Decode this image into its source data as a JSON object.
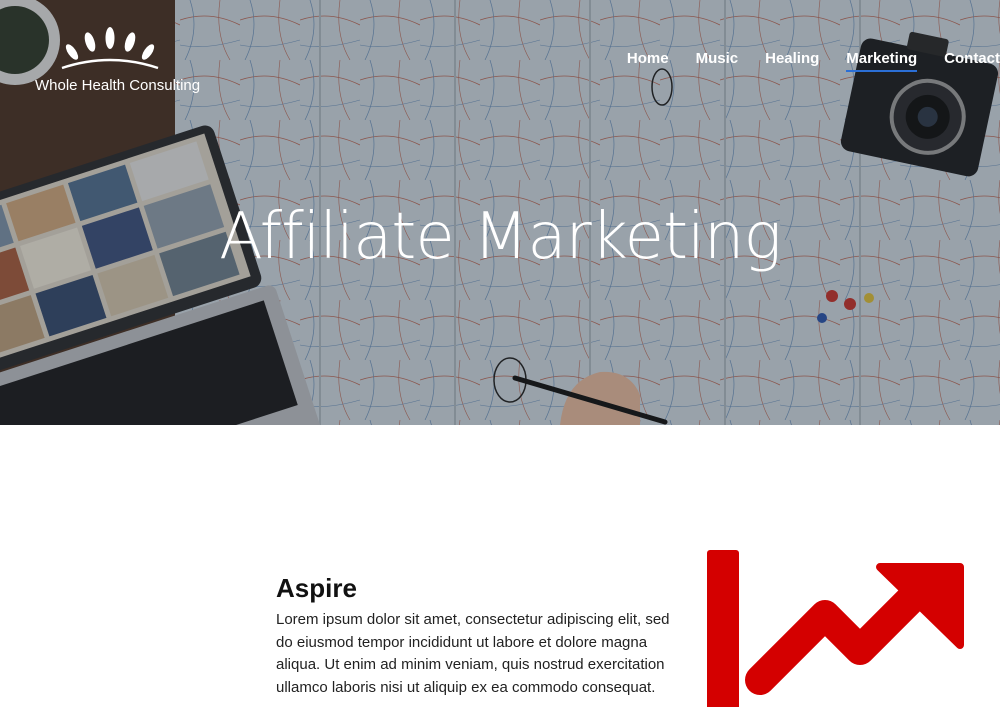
{
  "brand": {
    "name": "Whole Health Consulting"
  },
  "nav": {
    "items": [
      {
        "label": "Home",
        "active": false
      },
      {
        "label": "Music",
        "active": false
      },
      {
        "label": "Healing",
        "active": false
      },
      {
        "label": "Marketing",
        "active": true
      },
      {
        "label": "Contact",
        "active": false
      }
    ]
  },
  "hero": {
    "title": "Affiliate Marketing"
  },
  "section": {
    "title": "Aspire",
    "body": "Lorem ipsum dolor sit amet, consectetur adipiscing elit, sed do eiusmod tempor incididunt ut labore et dolore magna aliqua. Ut enim ad minim veniam, quis nostrud exercitation ullamco laboris nisi ut aliquip ex ea commodo consequat."
  },
  "colors": {
    "accent_underline": "#2b6fd6",
    "graphic_red": "#d40000"
  },
  "icons": {
    "trend": "upward-trend-arrow-icon",
    "logo": "crown-petals-icon"
  }
}
